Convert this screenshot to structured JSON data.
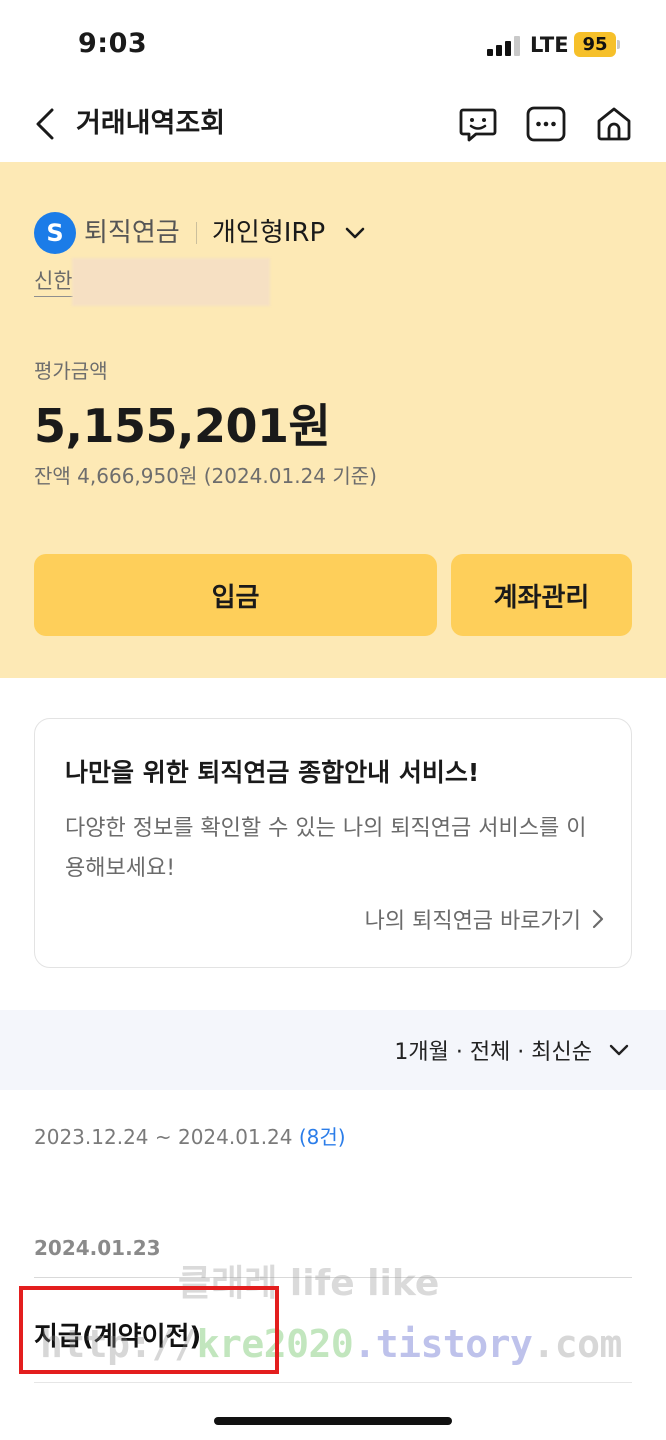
{
  "status_bar": {
    "time": "9:03",
    "network": "LTE",
    "battery": "95",
    "battery_color": "#f6c02a"
  },
  "nav": {
    "title": "거래내역조회",
    "icons": [
      "back-chevron-icon",
      "chatbot-icon",
      "more-icon",
      "home-icon"
    ]
  },
  "account": {
    "bank_logo": "S",
    "type": "퇴직연금",
    "product": "개인형IRP",
    "holder": "신한",
    "eval_label": "평가금액",
    "eval_amount": "5,155,201원",
    "balance_info": "잔액 4,666,950원 (2024.01.24 기준)",
    "deposit_button": "입금",
    "manage_button": "계좌관리",
    "card_bg": "#fde9b5",
    "button_color": "#fecf5a"
  },
  "promo": {
    "title": "나만을 위한 퇴직연금 종합안내 서비스!",
    "description": "다양한 정보를 확인할 수 있는 나의 퇴직연금 서비스를 이용해보세요!",
    "link": "나의 퇴직연금 바로가기"
  },
  "filter": {
    "label": "1개월 · 전체 · 최신순"
  },
  "transactions": {
    "range": "2023.12.24 ~ 2024.01.24",
    "count": "(8건)",
    "groups": [
      {
        "date": "2024.01.23",
        "items": [
          {
            "title": "지급(계약이전)"
          }
        ]
      }
    ]
  },
  "watermark": {
    "line1": "클래레 life like",
    "url_part1": "http://",
    "url_part2": "kre2020",
    "url_part3": ".tistory",
    "url_part4": ".com"
  },
  "annotation": {
    "highlight_color": "#e31e1e"
  }
}
